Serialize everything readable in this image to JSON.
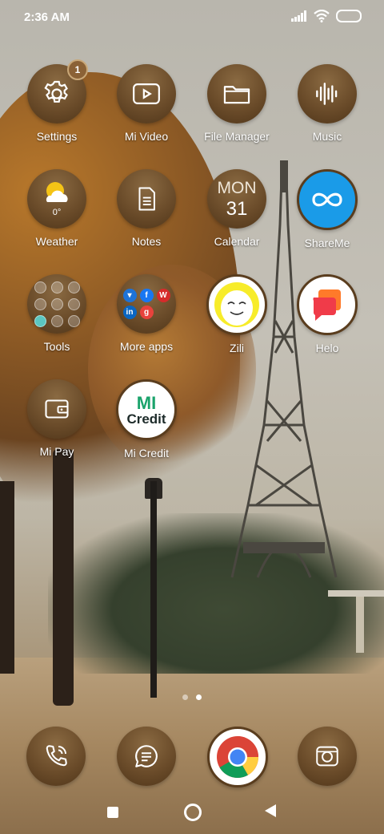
{
  "status_bar": {
    "time": "2:36 AM"
  },
  "apps": [
    {
      "label": "Settings",
      "icon": "gear-icon",
      "badge": "1"
    },
    {
      "label": "Mi Video",
      "icon": "play-icon"
    },
    {
      "label": "File Manager",
      "icon": "folder-icon"
    },
    {
      "label": "Music",
      "icon": "music-wave-icon"
    },
    {
      "label": "Weather",
      "icon": "weather-sun-cloud-icon",
      "temperature": "0°"
    },
    {
      "label": "Notes",
      "icon": "note-icon"
    },
    {
      "label": "Calendar",
      "icon": "calendar-icon",
      "day": "MON",
      "date": "31"
    },
    {
      "label": "ShareMe",
      "icon": "shareme-infinity-icon"
    },
    {
      "label": "Tools",
      "icon": "folder-tools-icon"
    },
    {
      "label": "More apps",
      "icon": "folder-more-apps-icon"
    },
    {
      "label": "Zili",
      "icon": "zili-face-icon"
    },
    {
      "label": "Helo",
      "icon": "helo-chat-icon"
    },
    {
      "label": "Mi Pay",
      "icon": "wallet-icon"
    },
    {
      "label": "Mi Credit",
      "icon": "mi-credit-logo-icon",
      "logo_text": "Credit",
      "logo_mi": "MI"
    }
  ],
  "page_indicator": {
    "pages": 2,
    "active": 2
  },
  "dock": [
    {
      "name": "phone",
      "icon": "phone-icon"
    },
    {
      "name": "messages",
      "icon": "message-icon"
    },
    {
      "name": "chrome",
      "icon": "chrome-icon"
    },
    {
      "name": "camera",
      "icon": "camera-icon"
    }
  ],
  "colors": {
    "icon_brown": "#6b4c2a",
    "shareme_blue": "#1a9be8",
    "mi_credit_green": "#1aa36b"
  }
}
